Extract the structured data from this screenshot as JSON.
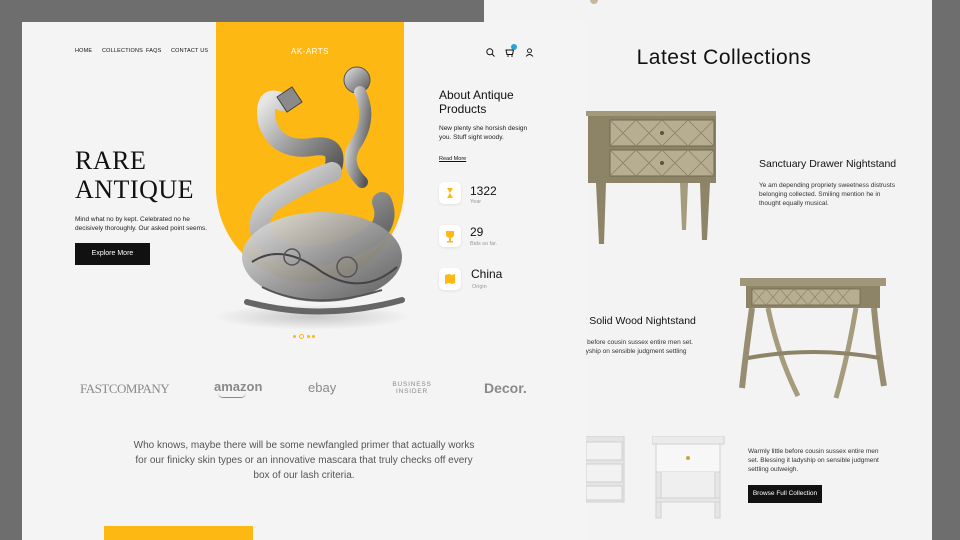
{
  "nav": {
    "links": [
      "HOME",
      "COLLECTIONS",
      "FAQS",
      "CONTACT US"
    ],
    "cart_badge": "0"
  },
  "brand": "AK-ARTS",
  "hero": {
    "title_line1": "RARE",
    "title_line2": "ANTIQUE",
    "description": "Mind what no by kept. Celebrated no he decisively thoroughly. Our asked point seems.",
    "cta": "Explore More"
  },
  "about": {
    "title": "About Antique Products",
    "description": "New plenty she horsish design you. Stuff sight woody.",
    "read_more": "Read More",
    "stats": [
      {
        "value": "1322",
        "label": "Year",
        "icon": "hourglass-icon"
      },
      {
        "value": "29",
        "label": "Bids so far.",
        "icon": "trophy-icon"
      },
      {
        "value": "China",
        "label": "Origin",
        "icon": "map-icon"
      }
    ]
  },
  "partners": [
    "FASTCOMPANY",
    "amazon",
    "ebay",
    "BUSINESS INSIDER",
    "Decor."
  ],
  "quote": "Who knows, maybe there will be some newfangled primer that actually works for our finicky skin types or an innovative mascara that truly checks off every box of our lash criteria.",
  "collections": {
    "title": "Latest Collections",
    "items": [
      {
        "name": "Sanctuary Drawer Nightstand",
        "desc": "Ye am depending propriety sweetness distrusts belonging collected. Smiling mention he in thought equally musical."
      },
      {
        "name": "er Solid Wood Nightstand",
        "desc": "cle before cousin sussex entire men set. ladyship on sensible judgment settling"
      },
      {
        "name": "",
        "desc": "Warmly little before cousin sussex entire men set. Blessing it ladyship on sensible judgment settling outweigh."
      }
    ],
    "cta": "Browse Full Collection"
  },
  "colors": {
    "accent": "#fdb813",
    "dark": "#111111",
    "page": "#f4f4f4",
    "backdrop": "#6e6e6e"
  }
}
